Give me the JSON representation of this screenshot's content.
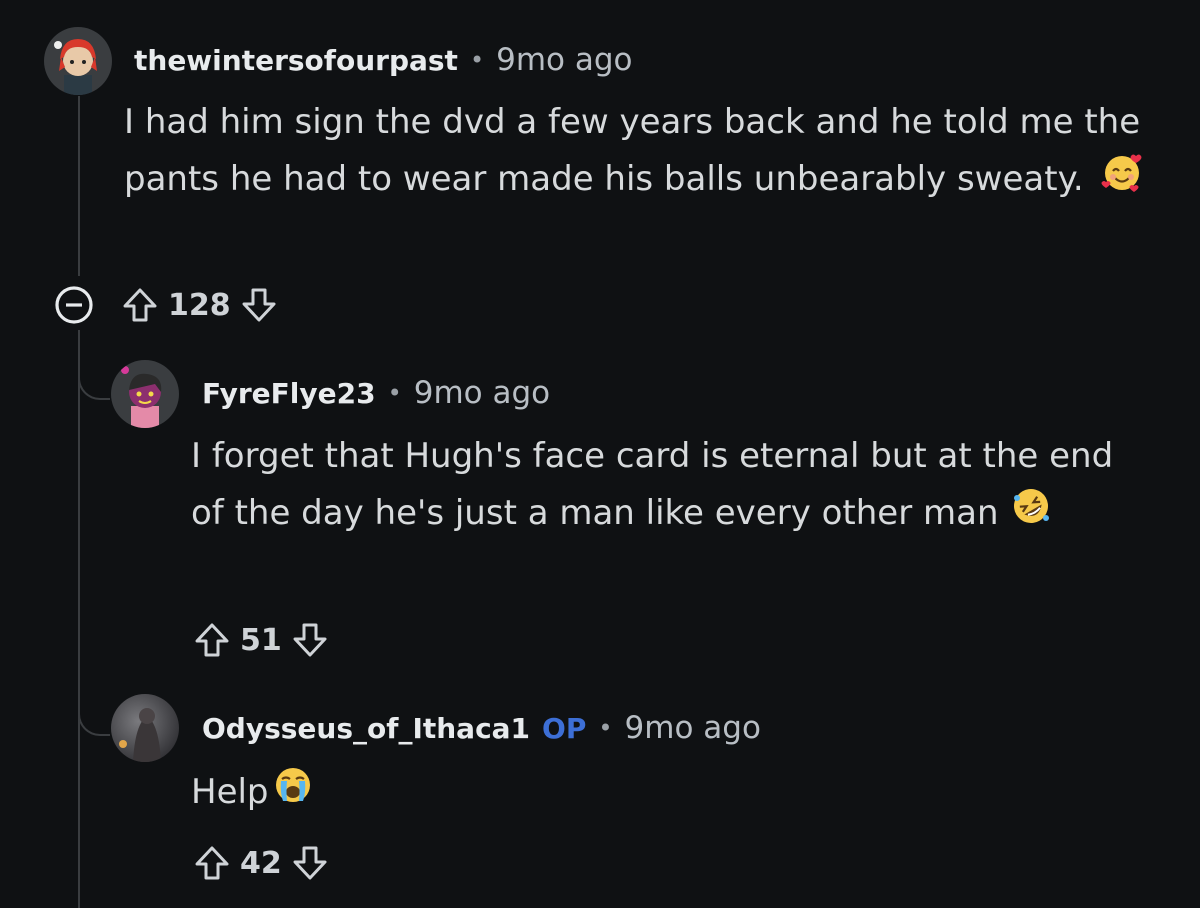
{
  "comments": [
    {
      "username": "thewintersofourpast",
      "separator": "•",
      "time": "9mo ago",
      "body": "I had him sign the dvd a few years back and he told me the pants he had to wear made his balls unbearably sweaty.",
      "emoji": "smiling-face-with-hearts",
      "votes": "128"
    },
    {
      "username": "FyreFlye23",
      "separator": "•",
      "time": "9mo ago",
      "body": "I forget that Hugh's face card is eternal but at the end of the day he's just a man like every other man",
      "emoji": "rolling-on-floor-laughing",
      "votes": "51"
    },
    {
      "username": "Odysseus_of_Ithaca1",
      "op_tag": "OP",
      "separator": "•",
      "time": "9mo ago",
      "body": "Help",
      "emoji": "loudly-crying-face",
      "votes": "42"
    }
  ],
  "colors": {
    "background": "#0f1113",
    "op_tag": "#3d6fd6",
    "thread_line": "#3a3d40"
  }
}
